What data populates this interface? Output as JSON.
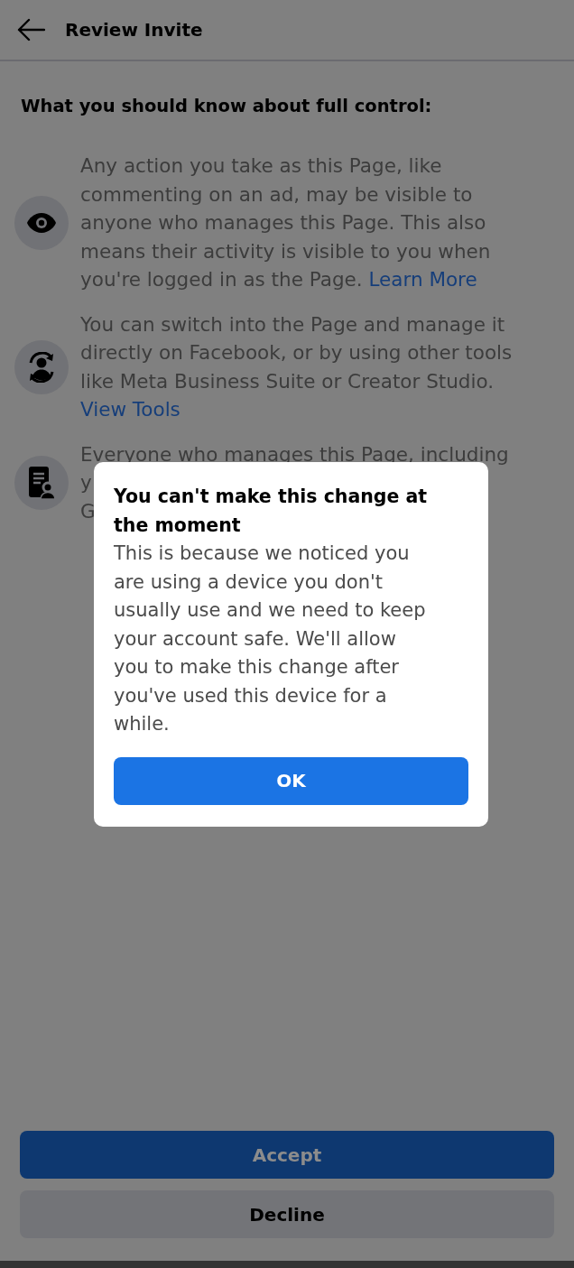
{
  "header": {
    "title": "Review Invite"
  },
  "heading": "What you should know about full control:",
  "items": [
    {
      "kind": "eye",
      "text": "Any action you take as this Page, like commenting on an ad, may be visible to anyone who manages this Page. This also means their activity is visible to you when you're logged in as the Page.",
      "link": "Learn More"
    },
    {
      "kind": "switch",
      "text": "You can switch into the Page and manage it directly on Facebook, or by using other tools like Meta Business Suite or Creator Studio.",
      "link": "View Tools"
    },
    {
      "kind": "document",
      "lines": [
        "Everyone who manages this Page, including",
        "y",
        "G"
      ]
    }
  ],
  "dialog": {
    "title": "You can't make this change at the moment",
    "body": "This is because we noticed you are using a device you don't usually use and we need to keep your account safe. We'll allow you to make this change after you've used this device for a while.",
    "button": "OK"
  },
  "buttons": [
    {
      "kind": "primary",
      "label": "Accept"
    },
    {
      "kind": "secondary",
      "label": "Decline"
    }
  ]
}
